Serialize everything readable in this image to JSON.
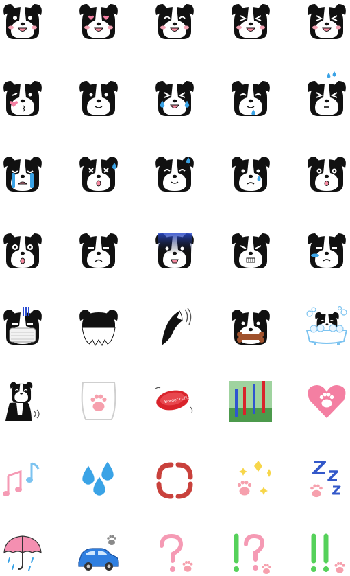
{
  "sheet": {
    "title": "",
    "background": "#ffffff"
  },
  "palette": {
    "fur_black": "#111111",
    "fur_white": "#ffffff",
    "blush": "#f4a3b4",
    "tongue": "#f58aa0",
    "tear_blue": "#3aa3e6",
    "heart_pink": "#f47fa2",
    "paw_pink": "#f6a0ad",
    "note_pink": "#f59ab4",
    "note_blue": "#7cc3f0",
    "anger_red": "#c9413c",
    "sparkle_yellow": "#f7d64a",
    "zzz_blue": "#3358c9",
    "bang_green": "#55d15a",
    "car_blue": "#2f7fe0",
    "umbrella_pink": "#f48fb1",
    "frisbee_red": "#d9232b"
  },
  "frisbee_text": "Border collie",
  "emoji": [
    {
      "name": "collie-smile-open-icon"
    },
    {
      "name": "collie-heart-eyes-icon"
    },
    {
      "name": "collie-happy-blush-icon"
    },
    {
      "name": "collie-squint-laugh-icon"
    },
    {
      "name": "collie-grin-icon"
    },
    {
      "name": "collie-kiss-heart-icon"
    },
    {
      "name": "collie-calm-smile-icon"
    },
    {
      "name": "collie-laugh-tears-icon"
    },
    {
      "name": "collie-drool-icon"
    },
    {
      "name": "collie-panic-sweat-icon"
    },
    {
      "name": "collie-crying-icon"
    },
    {
      "name": "collie-dizzy-icon"
    },
    {
      "name": "collie-sweat-smile-icon"
    },
    {
      "name": "collie-sad-icon"
    },
    {
      "name": "collie-shocked-icon"
    },
    {
      "name": "collie-surprised-icon"
    },
    {
      "name": "collie-frown-icon"
    },
    {
      "name": "collie-gloomy-icon"
    },
    {
      "name": "collie-angry-icon"
    },
    {
      "name": "collie-teary-icon"
    },
    {
      "name": "collie-mask-icon"
    },
    {
      "name": "collie-back-of-head-icon"
    },
    {
      "name": "collie-wagging-tail-icon"
    },
    {
      "name": "collie-bone-in-mouth-icon"
    },
    {
      "name": "collie-bath-icon"
    },
    {
      "name": "collie-sitting-icon"
    },
    {
      "name": "collie-paw-pad-icon"
    },
    {
      "name": "frisbee-icon"
    },
    {
      "name": "agility-poles-icon"
    },
    {
      "name": "heart-paw-icon"
    },
    {
      "name": "music-notes-icon"
    },
    {
      "name": "water-drops-icon"
    },
    {
      "name": "anger-mark-icon"
    },
    {
      "name": "sparkle-paw-icon"
    },
    {
      "name": "sleeping-zzz-icon"
    },
    {
      "name": "umbrella-rain-icon"
    },
    {
      "name": "car-paw-icon"
    },
    {
      "name": "question-paw-icon"
    },
    {
      "name": "exclaim-question-paw-icon"
    },
    {
      "name": "double-exclaim-paw-icon"
    }
  ]
}
